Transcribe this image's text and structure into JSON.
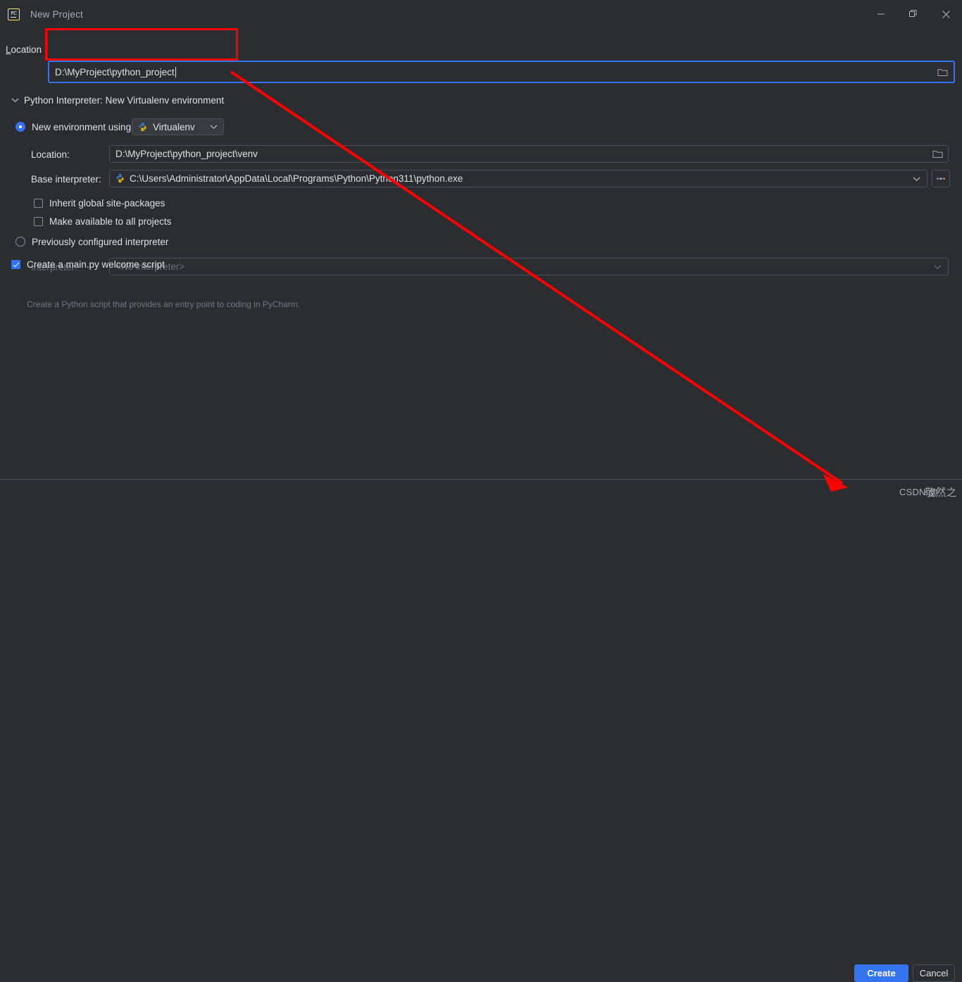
{
  "window": {
    "title": "New Project",
    "app_icon": "pycharm-icon",
    "icon_text": "PC",
    "controls": {
      "minimize": "minimize-icon",
      "restore": "restore-icon",
      "close": "close-icon"
    }
  },
  "location": {
    "label": "Location",
    "mnemonic": "L",
    "label_rest": "ocation",
    "value": "D:\\MyProject\\python_project",
    "browse_icon": "folder-icon"
  },
  "interpreter_section": {
    "chevron": "chevron-down-icon",
    "title": "Python Interpreter: New Virtualenv environment",
    "new_env": {
      "label": "New environment using",
      "selected": true,
      "combo_value": "Virtualenv",
      "combo_icon": "python-venv-icon",
      "combo_chevron": "chevron-down-icon"
    },
    "venv_location": {
      "label": "Location:",
      "value": "D:\\MyProject\\python_project\\venv",
      "browse_icon": "folder-icon"
    },
    "base_interpreter": {
      "label": "Base interpreter:",
      "value": "C:\\Users\\Administrator\\AppData\\Local\\Programs\\Python\\Python311\\python.exe",
      "icon": "python-icon",
      "chevron": "chevron-down-icon",
      "more_button": "ellipsis-button"
    },
    "checkboxes": [
      {
        "label": "Inherit global site-packages",
        "checked": false
      },
      {
        "label": "Make available to all projects",
        "checked": false
      }
    ],
    "previous_interpreter": {
      "label": "Previously configured interpreter",
      "selected": false,
      "field_label": "Interpreter:",
      "field_value": "<No interpreter>",
      "disabled": true,
      "chevron": "chevron-down-icon"
    }
  },
  "welcome_script": {
    "label": "Create a main.py welcome script",
    "checked": true,
    "hint": "Create a Python script that provides an entry point to coding in PyCharm."
  },
  "footer": {
    "create_label": "Create",
    "cancel_label": "Cancel"
  },
  "annotations": {
    "highlight_color": "#fe0000",
    "arrow_color": "#fe0000",
    "watermark": "CSDN @",
    "watermark_suffix": "敬然之"
  },
  "theme": {
    "background": "#2b2d30",
    "accent": "#3574f0",
    "border": "#4b4f56",
    "text": "#dfe1e5",
    "muted_text": "#6e7278"
  }
}
